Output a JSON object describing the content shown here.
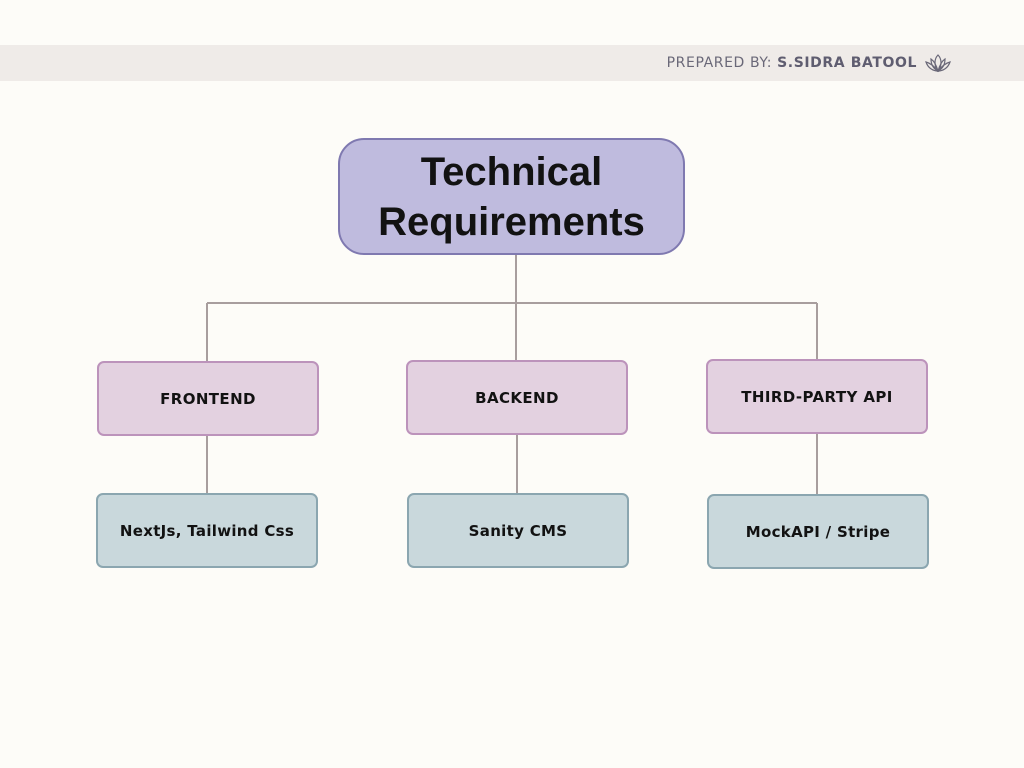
{
  "header": {
    "prepared_label": "PREPARED BY: ",
    "author": "S.SIDRA BATOOL",
    "logo_icon": "lotus-icon"
  },
  "diagram": {
    "root": {
      "line1": "Technical",
      "line2": "Requirements"
    },
    "branches": [
      {
        "category": "FRONTEND",
        "item": "NextJs, Tailwind Css"
      },
      {
        "category": "BACKEND",
        "item": "Sanity CMS"
      },
      {
        "category": "THIRD-PARTY API",
        "item": "MockAPI / Stripe"
      }
    ]
  },
  "colors": {
    "background": "#fdfcf8",
    "header_band": "#efebe8",
    "root_fill": "#bfbbde",
    "root_border": "#7f79b0",
    "category_fill": "#e3d1e0",
    "category_border": "#bc93bb",
    "leaf_fill": "#c9d8dc",
    "leaf_border": "#8ba6b0",
    "connector": "#a89e9e"
  }
}
